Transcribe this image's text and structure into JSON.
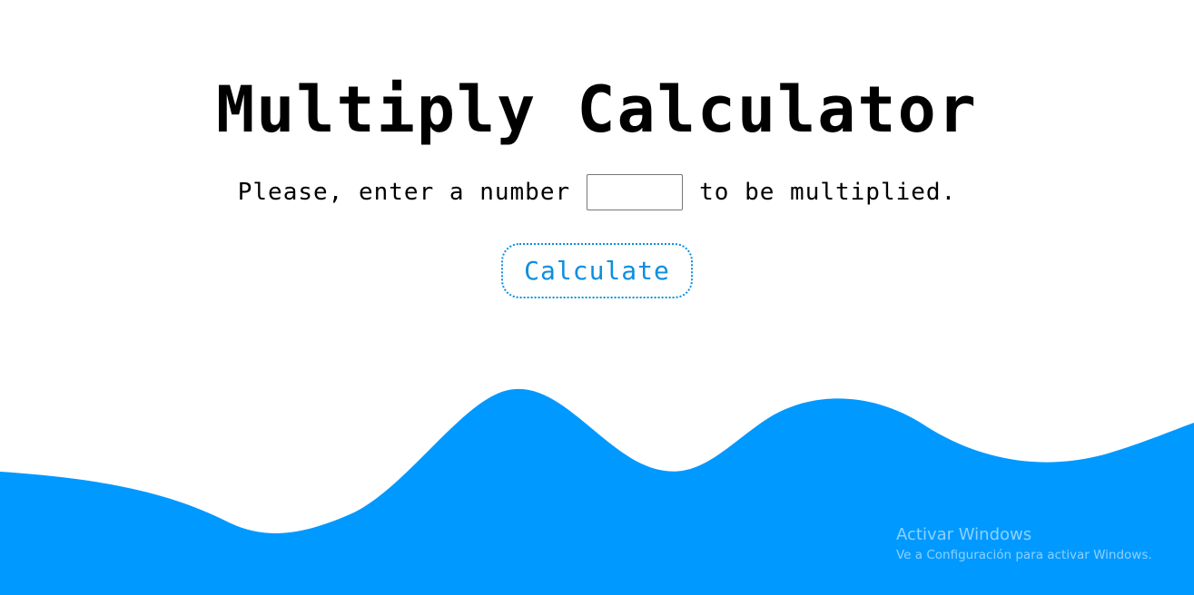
{
  "header": {
    "title": "Multiply Calculator"
  },
  "form": {
    "prompt_before": "Please, enter a number",
    "prompt_after": "to be multiplied.",
    "input_value": "",
    "input_placeholder": "",
    "button_label": "Calculate"
  },
  "watermark": {
    "title": "Activar Windows",
    "subtitle": "Ve a Configuración para activar Windows."
  },
  "colors": {
    "accent": "#0a8fe0",
    "wave": "#0099ff",
    "text": "#000000",
    "background": "#ffffff"
  }
}
